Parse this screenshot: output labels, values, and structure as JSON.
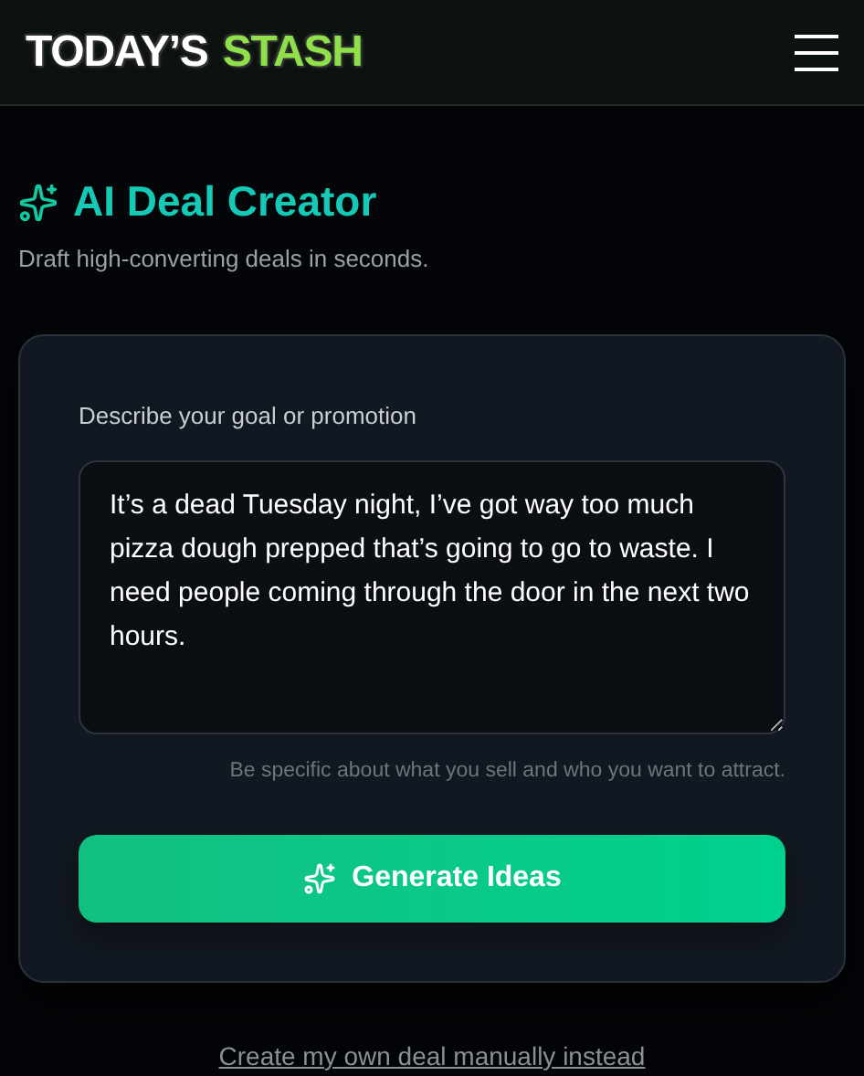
{
  "header": {
    "logo": [
      "TODAY’S",
      "STASH"
    ]
  },
  "page": {
    "title": "AI Deal Creator",
    "subtitle": "Draft high-converting deals in seconds."
  },
  "form": {
    "label": "Describe your goal or promotion",
    "value": "It’s a dead Tuesday night, I’ve got way too much pizza dough prepped that’s going to go to waste. I need people coming through the door in the next two hours.",
    "hint": "Be specific about what you sell and who you want to attract.",
    "button": "Generate Ideas"
  },
  "link": "Create my own deal manually instead"
}
